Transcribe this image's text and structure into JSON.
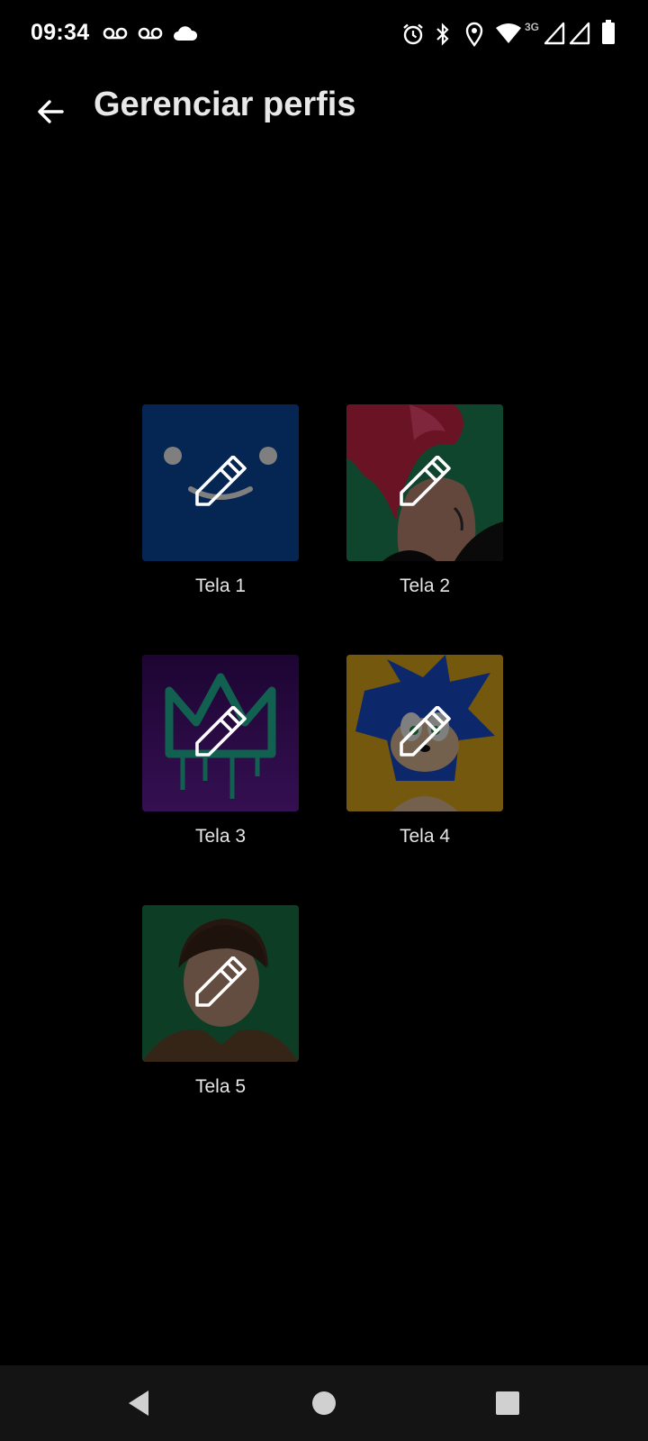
{
  "status_bar": {
    "time": "09:34",
    "network_label": "3G",
    "left_icons": [
      "voicemail-icon",
      "voicemail-icon",
      "cloud-icon"
    ],
    "right_icons": [
      "alarm-icon",
      "bluetooth-icon",
      "location-icon",
      "wifi-icon",
      "signal-icon",
      "signal-icon",
      "battery-icon"
    ]
  },
  "header": {
    "title": "Gerenciar perfis",
    "back_icon": "arrow-back-icon"
  },
  "profiles": [
    {
      "name": "Tela 1",
      "avatar": "blue-smiley-avatar",
      "overlay_icon": "pencil-edit-icon"
    },
    {
      "name": "Tela 2",
      "avatar": "red-hair-character-avatar",
      "overlay_icon": "pencil-edit-icon"
    },
    {
      "name": "Tela 3",
      "avatar": "purple-crown-graffiti-avatar",
      "overlay_icon": "pencil-edit-icon"
    },
    {
      "name": "Tela 4",
      "avatar": "sonic-avatar",
      "overlay_icon": "pencil-edit-icon"
    },
    {
      "name": "Tela 5",
      "avatar": "young-man-avatar",
      "overlay_icon": "pencil-edit-icon"
    }
  ],
  "nav_bar": {
    "buttons": [
      "back-triangle-icon",
      "home-circle-icon",
      "recents-square-icon"
    ]
  },
  "colors": {
    "background": "#000000",
    "nav_bar": "#141414",
    "text": "#e6e6e6"
  }
}
